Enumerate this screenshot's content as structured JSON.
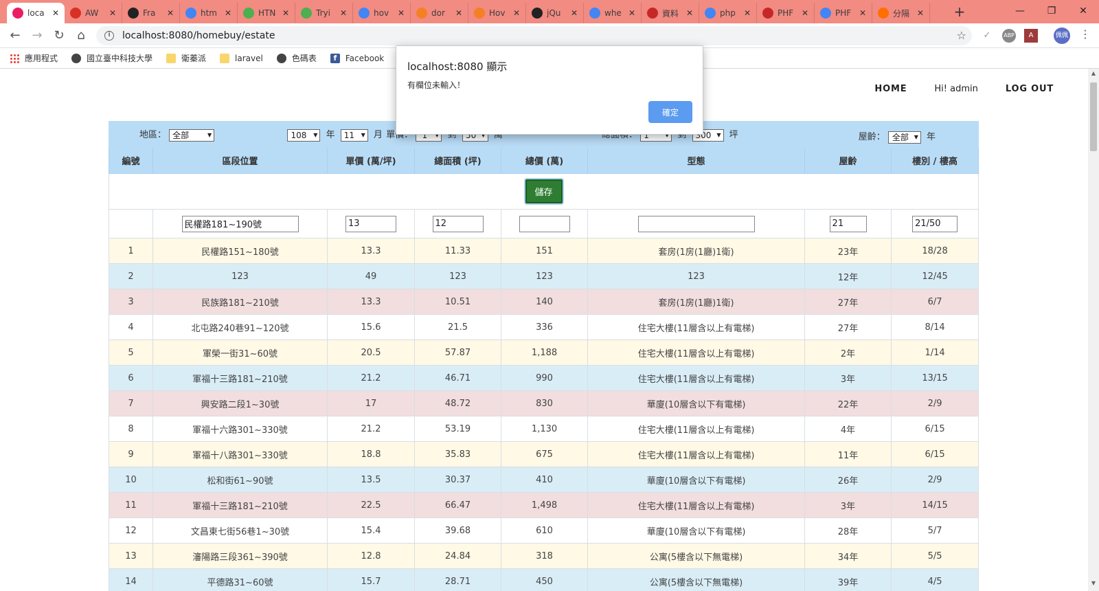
{
  "browser": {
    "tabs": [
      {
        "title": "loca",
        "icon": "page-icon",
        "color": "#e91e63",
        "active": true
      },
      {
        "title": "AW",
        "icon": "gmail-icon",
        "color": "#d93025"
      },
      {
        "title": "Fra",
        "icon": "github-icon",
        "color": "#222222"
      },
      {
        "title": "htm",
        "icon": "google-icon",
        "color": "#4285f4"
      },
      {
        "title": "HTN",
        "icon": "w3schools-icon",
        "color": "#4caf50"
      },
      {
        "title": "Tryi",
        "icon": "w3schools-icon",
        "color": "#4caf50"
      },
      {
        "title": "hov",
        "icon": "google-icon",
        "color": "#4285f4"
      },
      {
        "title": "dor",
        "icon": "stackoverflow-icon",
        "color": "#f48024"
      },
      {
        "title": "Hov",
        "icon": "stackoverflow-icon",
        "color": "#f48024"
      },
      {
        "title": "jQu",
        "icon": "jquery-icon",
        "color": "#222222"
      },
      {
        "title": "whe",
        "icon": "google-icon",
        "color": "#4285f4"
      },
      {
        "title": "資料",
        "icon": "page-icon",
        "color": "#c62828"
      },
      {
        "title": "php",
        "icon": "google-icon",
        "color": "#4285f4"
      },
      {
        "title": "PHF",
        "icon": "page-icon",
        "color": "#c62828"
      },
      {
        "title": "PHF",
        "icon": "google-icon",
        "color": "#4285f4"
      },
      {
        "title": "分隔",
        "icon": "blogger-icon",
        "color": "#ff6f00"
      }
    ],
    "url": "localhost:8080/homebuy/estate",
    "profile_label": "佩佩",
    "bookmarks": [
      {
        "label": "應用程式",
        "icon": "apps-icon"
      },
      {
        "label": "國立臺中科技大學",
        "icon": "globe-icon"
      },
      {
        "label": "衛蓁派",
        "icon": "folder-icon"
      },
      {
        "label": "laravel",
        "icon": "folder-icon"
      },
      {
        "label": "色碼表",
        "icon": "globe-icon"
      },
      {
        "label": "Facebook",
        "icon": "facebook-icon"
      }
    ]
  },
  "nav": {
    "home": "HOME",
    "greeting": "Hi! admin",
    "logout": "LOG OUT"
  },
  "filters": {
    "area_label": "地區：",
    "area_value": "全部",
    "year_value": "108",
    "year_label": "年",
    "month_value": "11",
    "month_label": "月",
    "price_label": "單價：",
    "price_from": "1",
    "to_label": "到",
    "price_to": "50",
    "price_unit": "萬",
    "size_label": "總面積：",
    "size_from": "1",
    "size_to": "300",
    "size_unit": "坪",
    "age_label": "屋齡：",
    "age_value": "全部",
    "age_unit": "年"
  },
  "columns": [
    "編號",
    "區段位置",
    "單價 (萬/坪)",
    "總面積 (坪)",
    "總價 (萬)",
    "型態",
    "屋齡",
    "樓別 / 樓高"
  ],
  "save_label": "儲存",
  "form": {
    "location": "民權路181~190號",
    "unit_price": "13",
    "size": "12",
    "total_price": "",
    "type": "",
    "age": "21",
    "floor": "21/50"
  },
  "rows": [
    {
      "no": "1",
      "loc": "民權路151~180號",
      "unit": "13.3",
      "size": "11.33",
      "total": "151",
      "type": "套房(1房(1廳)1衛)",
      "age": "23年",
      "floor": "18/28",
      "color": "yellow"
    },
    {
      "no": "2",
      "loc": "123",
      "unit": "49",
      "size": "123",
      "total": "123",
      "type": "123",
      "age": "12年",
      "floor": "12/45",
      "color": "blue"
    },
    {
      "no": "3",
      "loc": "民族路181~210號",
      "unit": "13.3",
      "size": "10.51",
      "total": "140",
      "type": "套房(1房(1廳)1衛)",
      "age": "27年",
      "floor": "6/7",
      "color": "red"
    },
    {
      "no": "4",
      "loc": "北屯路240巷91~120號",
      "unit": "15.6",
      "size": "21.5",
      "total": "336",
      "type": "住宅大樓(11層含以上有電梯)",
      "age": "27年",
      "floor": "8/14",
      "color": "white"
    },
    {
      "no": "5",
      "loc": "軍榮一街31~60號",
      "unit": "20.5",
      "size": "57.87",
      "total": "1,188",
      "type": "住宅大樓(11層含以上有電梯)",
      "age": "2年",
      "floor": "1/14",
      "color": "yellow"
    },
    {
      "no": "6",
      "loc": "軍福十三路181~210號",
      "unit": "21.2",
      "size": "46.71",
      "total": "990",
      "type": "住宅大樓(11層含以上有電梯)",
      "age": "3年",
      "floor": "13/15",
      "color": "blue"
    },
    {
      "no": "7",
      "loc": "興安路二段1~30號",
      "unit": "17",
      "size": "48.72",
      "total": "830",
      "type": "華廈(10層含以下有電梯)",
      "age": "22年",
      "floor": "2/9",
      "color": "red"
    },
    {
      "no": "8",
      "loc": "軍福十六路301~330號",
      "unit": "21.2",
      "size": "53.19",
      "total": "1,130",
      "type": "住宅大樓(11層含以上有電梯)",
      "age": "4年",
      "floor": "6/15",
      "color": "white"
    },
    {
      "no": "9",
      "loc": "軍福十八路301~330號",
      "unit": "18.8",
      "size": "35.83",
      "total": "675",
      "type": "住宅大樓(11層含以上有電梯)",
      "age": "11年",
      "floor": "6/15",
      "color": "yellow"
    },
    {
      "no": "10",
      "loc": "松和街61~90號",
      "unit": "13.5",
      "size": "30.37",
      "total": "410",
      "type": "華廈(10層含以下有電梯)",
      "age": "26年",
      "floor": "2/9",
      "color": "blue"
    },
    {
      "no": "11",
      "loc": "軍福十三路181~210號",
      "unit": "22.5",
      "size": "66.47",
      "total": "1,498",
      "type": "住宅大樓(11層含以上有電梯)",
      "age": "3年",
      "floor": "14/15",
      "color": "red"
    },
    {
      "no": "12",
      "loc": "文昌東七街56巷1~30號",
      "unit": "15.4",
      "size": "39.68",
      "total": "610",
      "type": "華廈(10層含以下有電梯)",
      "age": "28年",
      "floor": "5/7",
      "color": "white"
    },
    {
      "no": "13",
      "loc": "瀋陽路三段361~390號",
      "unit": "12.8",
      "size": "24.84",
      "total": "318",
      "type": "公寓(5樓含以下無電梯)",
      "age": "34年",
      "floor": "5/5",
      "color": "yellow"
    },
    {
      "no": "14",
      "loc": "平德路31~60號",
      "unit": "15.7",
      "size": "28.71",
      "total": "450",
      "type": "公寓(5樓含以下無電梯)",
      "age": "39年",
      "floor": "4/5",
      "color": "blue"
    }
  ],
  "dialog": {
    "title": "localhost:8080 顯示",
    "message": "有欄位未輸入！",
    "ok": "確定"
  }
}
